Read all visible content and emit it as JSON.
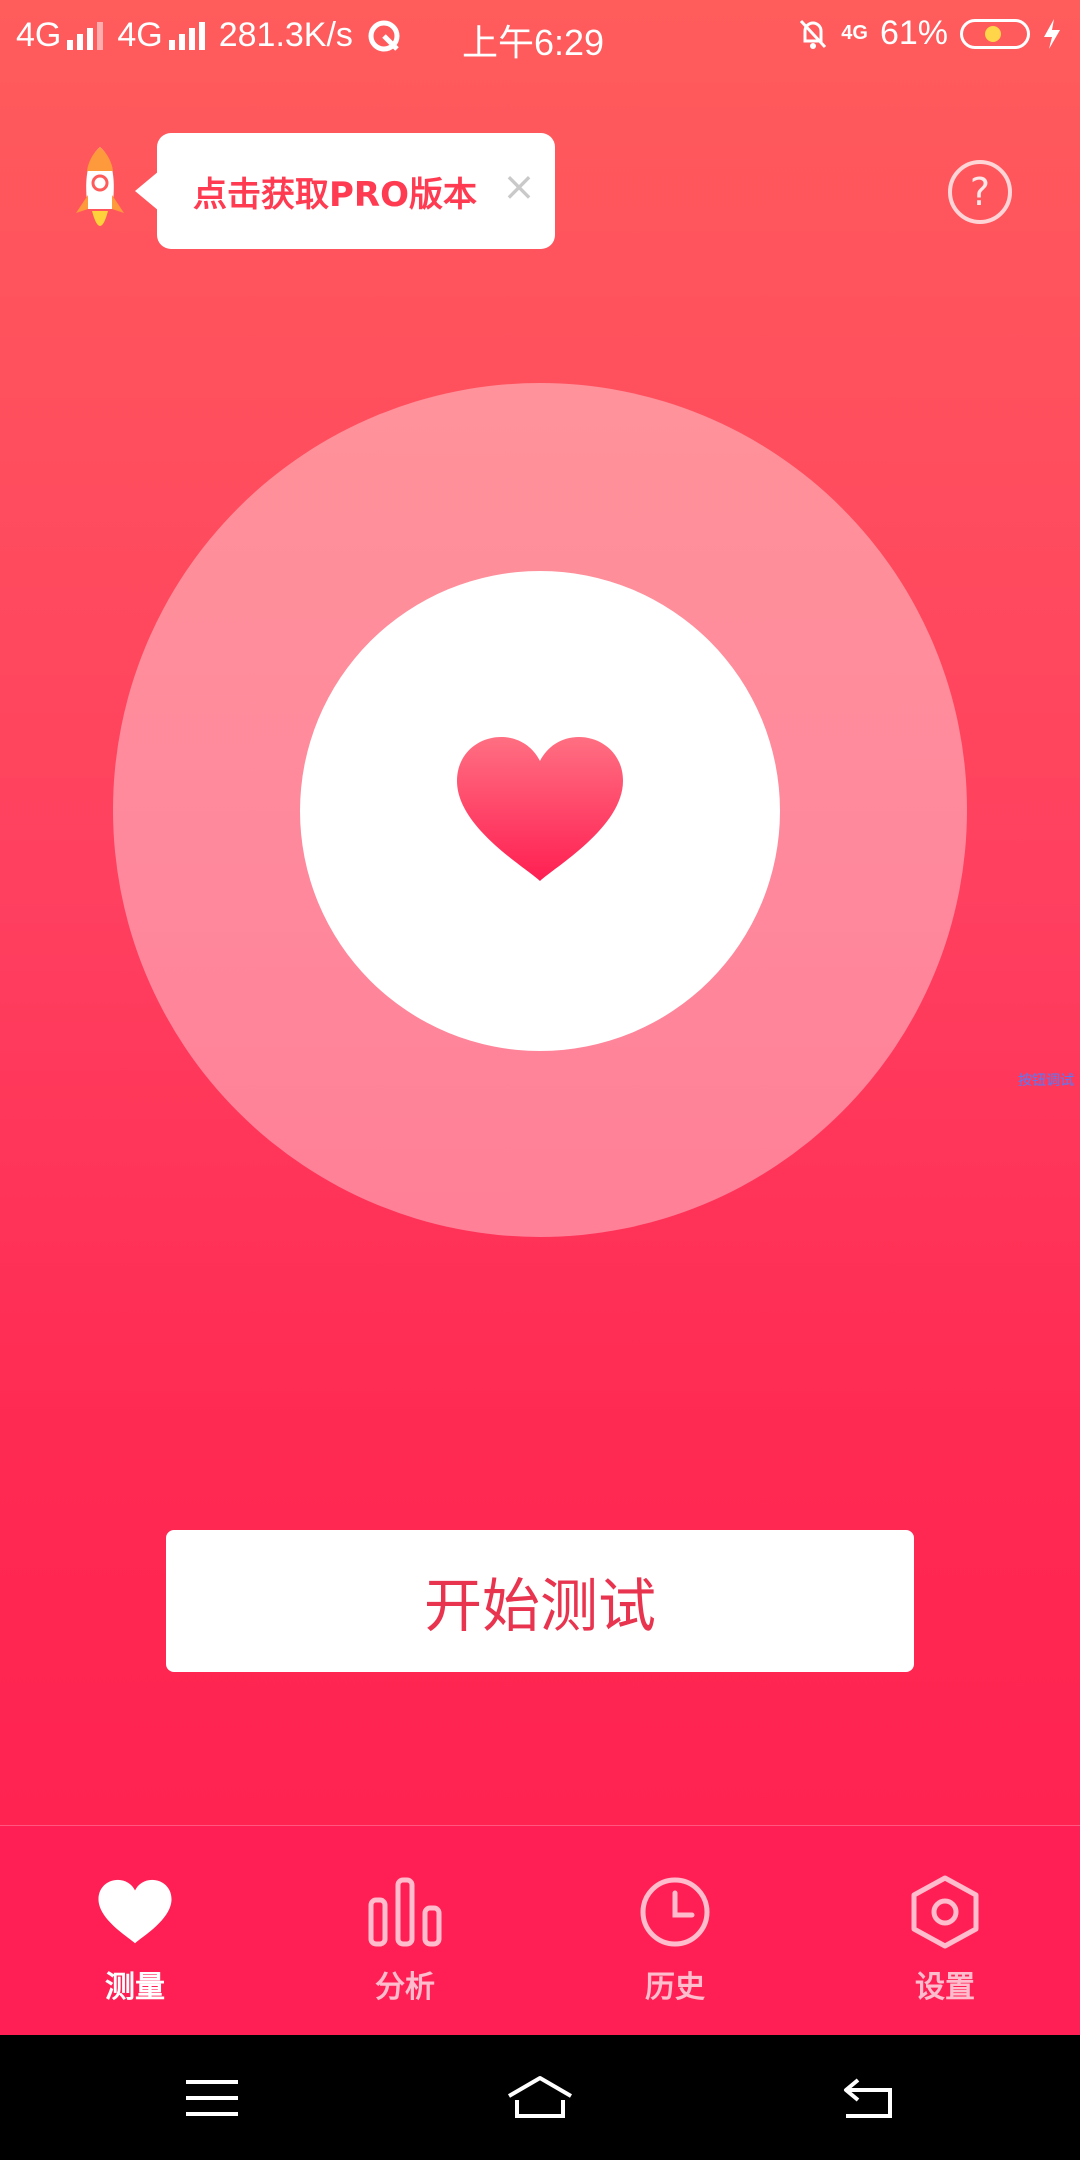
{
  "status_bar": {
    "sim1": "4G",
    "sim2": "4G",
    "net_speed": "281.3K/s",
    "time": "上午6:29",
    "net_type_small": "4G",
    "battery": "61%"
  },
  "promo": {
    "text": "点击获取PRO版本",
    "close": "×"
  },
  "help": {
    "label": "?"
  },
  "side_hint": "按钮调试",
  "start_button": {
    "label": "开始测试"
  },
  "tabs": [
    {
      "label": "测量",
      "icon": "heart-icon",
      "active": true
    },
    {
      "label": "分析",
      "icon": "bar-chart-icon",
      "active": false
    },
    {
      "label": "历史",
      "icon": "clock-icon",
      "active": false
    },
    {
      "label": "设置",
      "icon": "hexagon-settings-icon",
      "active": false
    }
  ],
  "colors": {
    "accent": "#ff2a52",
    "button_text": "#e8344f",
    "tab_bar": "#ff1f55"
  }
}
